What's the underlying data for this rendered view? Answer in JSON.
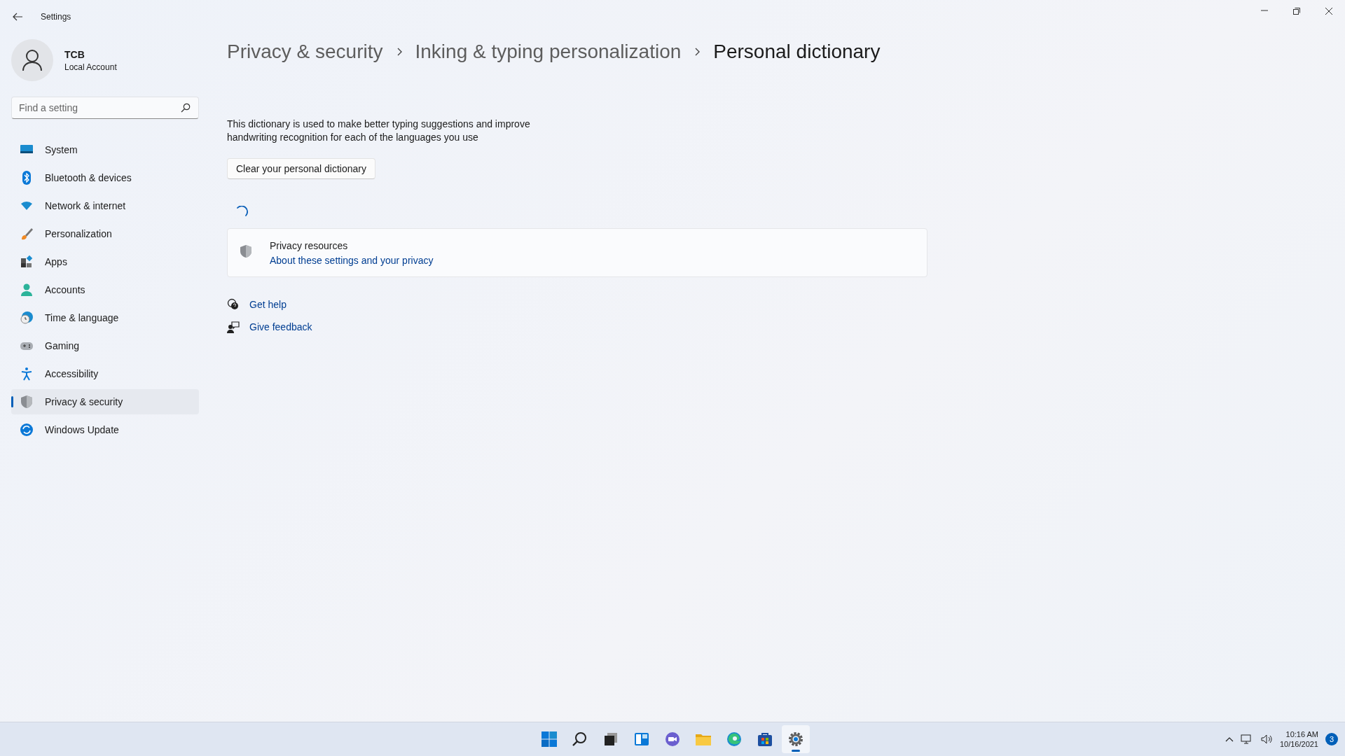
{
  "window": {
    "title": "Settings"
  },
  "account": {
    "name": "TCB",
    "type": "Local Account"
  },
  "search": {
    "placeholder": "Find a setting"
  },
  "sidebar": {
    "items": [
      {
        "label": "System",
        "kind": "system",
        "selected": false
      },
      {
        "label": "Bluetooth & devices",
        "kind": "bluetooth",
        "selected": false
      },
      {
        "label": "Network & internet",
        "kind": "network",
        "selected": false
      },
      {
        "label": "Personalization",
        "kind": "brush",
        "selected": false
      },
      {
        "label": "Apps",
        "kind": "apps",
        "selected": false
      },
      {
        "label": "Accounts",
        "kind": "accounts",
        "selected": false
      },
      {
        "label": "Time & language",
        "kind": "time",
        "selected": false
      },
      {
        "label": "Gaming",
        "kind": "gaming",
        "selected": false
      },
      {
        "label": "Accessibility",
        "kind": "accessibility",
        "selected": false
      },
      {
        "label": "Privacy & security",
        "kind": "privacy",
        "selected": true
      },
      {
        "label": "Windows Update",
        "kind": "update",
        "selected": false
      }
    ]
  },
  "breadcrumb": [
    "Privacy & security",
    "Inking & typing personalization",
    "Personal dictionary"
  ],
  "description": "This dictionary is used to make better typing suggestions and improve handwriting recognition for each of the languages you use",
  "clear_button": "Clear your personal dictionary",
  "loading": true,
  "privacy_card": {
    "title": "Privacy resources",
    "link": "About these settings and your privacy"
  },
  "help_links": [
    {
      "label": "Get help",
      "kind": "help"
    },
    {
      "label": "Give feedback",
      "kind": "feedback"
    }
  ],
  "taskbar": {
    "apps": [
      {
        "kind": "start",
        "selected": false
      },
      {
        "kind": "search",
        "selected": false
      },
      {
        "kind": "taskview",
        "selected": false
      },
      {
        "kind": "widgets",
        "selected": false
      },
      {
        "kind": "chat",
        "selected": false
      },
      {
        "kind": "explorer",
        "selected": false
      },
      {
        "kind": "edge",
        "selected": false
      },
      {
        "kind": "store",
        "selected": false
      },
      {
        "kind": "settings",
        "selected": true
      }
    ],
    "time": "10:16 AM",
    "date": "10/16/2021",
    "notifications": "3"
  }
}
